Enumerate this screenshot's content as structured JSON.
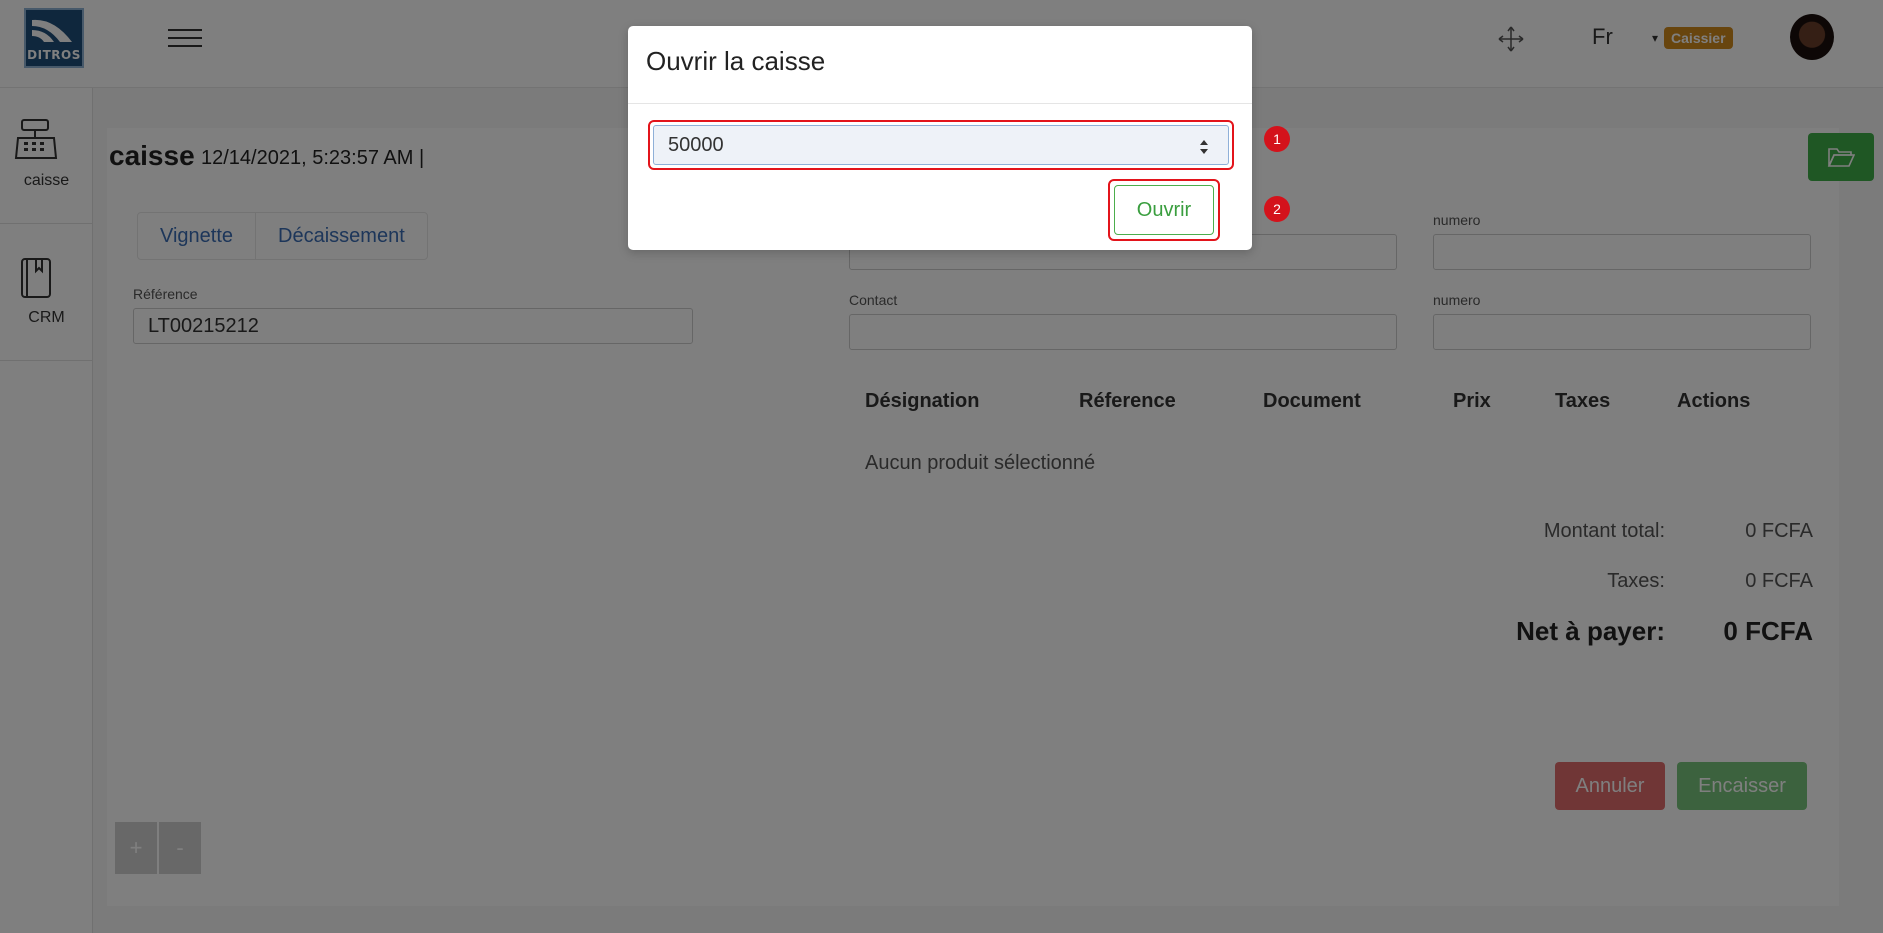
{
  "header": {
    "logo_text": "DITROS",
    "language": "Fr",
    "role_caret": "▾",
    "role_badge": "Caissier"
  },
  "sidebar": {
    "items": [
      {
        "label": "caisse",
        "icon": "cash-register-icon"
      },
      {
        "label": "CRM",
        "icon": "notebook-icon"
      }
    ]
  },
  "page": {
    "title": "caisse",
    "datetime": "12/14/2021, 5:23:57 AM |"
  },
  "tabs": [
    "Vignette",
    "Décaissement"
  ],
  "form": {
    "reference_label": "Référence",
    "reference_value": "LT00215212",
    "top_numero_label": "numero",
    "contact_label": "Contact",
    "numero_label": "numero"
  },
  "table": {
    "headers": [
      "Désignation",
      "Réference",
      "Document",
      "Prix",
      "Taxes",
      "Actions"
    ],
    "empty_text": "Aucun produit sélectionné"
  },
  "summary": {
    "total_label": "Montant total:",
    "total_value": "0 FCFA",
    "taxes_label": "Taxes:",
    "taxes_value": "0 FCFA",
    "net_label": "Net à payer:",
    "net_value": "0 FCFA"
  },
  "actions": {
    "cancel": "Annuler",
    "cash_in": "Encaisser",
    "plus": "+",
    "minus": "-"
  },
  "modal": {
    "title": "Ouvrir la caisse",
    "amount_value": "50000",
    "submit_label": "Ouvrir"
  },
  "annotations": {
    "step1": "1",
    "step2": "2"
  },
  "colors": {
    "accent_green": "#3fae48",
    "badge_orange": "#d08a1d",
    "highlight_red": "#e3141b"
  }
}
